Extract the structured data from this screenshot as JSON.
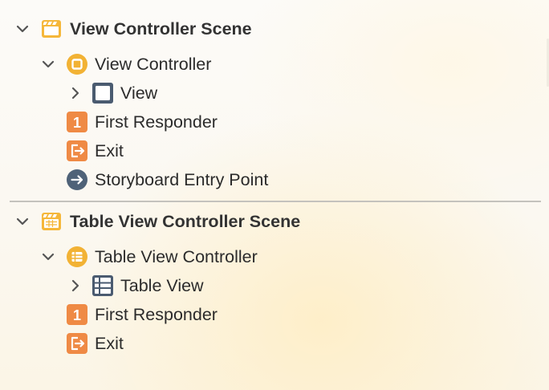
{
  "outline": {
    "scene1": {
      "title": "View Controller Scene",
      "icon": "scene-clapperboard-icon",
      "controller": "View Controller",
      "view": "View",
      "first_responder": "First Responder",
      "exit": "Exit",
      "entry_point": "Storyboard Entry Point"
    },
    "scene2": {
      "title": "Table View Controller Scene",
      "icon": "scene-clapperboard-icon",
      "controller": "Table View Controller",
      "view": "Table View",
      "first_responder": "First Responder",
      "exit": "Exit"
    }
  },
  "badges": {
    "first_responder": "1"
  },
  "colors": {
    "scene_icon": "#f5b73a",
    "controller_icon": "#f2b234",
    "view_icon": "#4a5b70",
    "first_responder_icon": "#ef8a45",
    "exit_icon": "#ef8a45",
    "entry_point_icon": "#4f6278",
    "chevron": "#555555",
    "divider": "#c4c2bd"
  }
}
